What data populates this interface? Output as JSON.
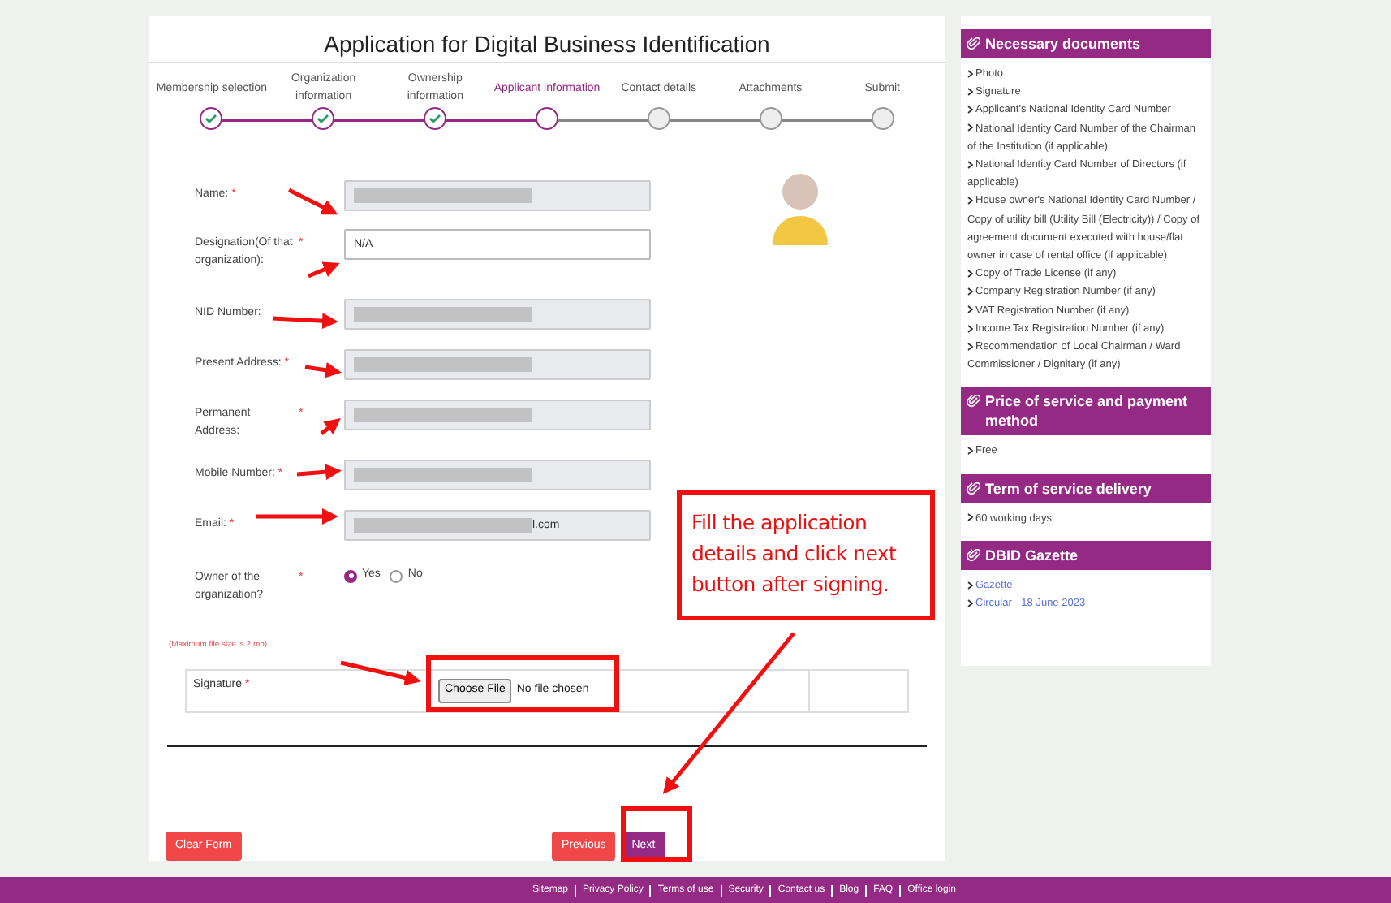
{
  "title": "Application for Digital Business Identification",
  "steps": [
    {
      "label": "Membership selection",
      "completed": true,
      "current": false
    },
    {
      "label": "Organization information",
      "completed": true,
      "current": false
    },
    {
      "label": "Ownership information",
      "completed": true,
      "current": false
    },
    {
      "label": "Applicant information",
      "completed": false,
      "current": true
    },
    {
      "label": "Contact details",
      "completed": false,
      "current": false
    },
    {
      "label": "Attachments",
      "completed": false,
      "current": false
    },
    {
      "label": "Submit",
      "completed": false,
      "current": false
    }
  ],
  "fields": [
    {
      "kind": "text",
      "label": "Name:",
      "required_mark": "*",
      "disabled": true,
      "redacted": true
    },
    {
      "kind": "text",
      "label": "Designation(Of that organization):",
      "required_mark": "*",
      "disabled": false,
      "value": "N/A"
    },
    {
      "kind": "text",
      "label": "NID Number:",
      "disabled": true,
      "redacted": true
    },
    {
      "kind": "text",
      "label": "Present Address:",
      "required_mark": "*",
      "disabled": true,
      "redacted": true
    },
    {
      "kind": "text",
      "label": "Permanent Address:",
      "required_mark": "*",
      "disabled": true,
      "redacted": true
    },
    {
      "kind": "text",
      "label": "Mobile Number:",
      "required_mark": "*",
      "disabled": true,
      "redacted": true
    },
    {
      "kind": "text",
      "label": "Email:",
      "required_mark": "*",
      "disabled": true,
      "redacted": true,
      "value": "l.com"
    },
    {
      "kind": "radio",
      "label": "Owner of the organization?",
      "required_mark": "*",
      "options": [
        {
          "label": "Yes",
          "selected": true
        },
        {
          "label": "No",
          "selected": false
        }
      ]
    }
  ],
  "file_note": "(Maximum file size is 2 mb)",
  "signature": {
    "label": "Signature",
    "required_mark": "*",
    "button": "Choose File",
    "status": "No file chosen"
  },
  "buttons": {
    "clear": "Clear Form",
    "previous": "Previous",
    "next": "Next"
  },
  "callout": "Fill the application details and click next button after signing.",
  "sidebar": [
    {
      "title": "Necessary documents",
      "items": [
        {
          "text": "Photo",
          "kind": "text"
        },
        {
          "text": "Signature",
          "kind": "text"
        },
        {
          "text": "Applicant's National Identity Card Number",
          "kind": "text"
        },
        {
          "text": "National Identity Card Number of the Chairman of the Institution (if applicable)",
          "kind": "text"
        },
        {
          "text": "National Identity Card Number of Directors (if applicable)",
          "kind": "text"
        },
        {
          "text": "House owner's National Identity Card Number / Copy of utility bill (Utility Bill (Electricity)) / Copy of agreement document executed with house/flat owner in case of rental office (if applicable)",
          "kind": "text"
        },
        {
          "text": "Copy of Trade License (if any)",
          "kind": "text"
        },
        {
          "text": "Company Registration Number (if any)",
          "kind": "text"
        },
        {
          "text": "VAT Registration Number (if any)",
          "kind": "text"
        },
        {
          "text": "Income Tax Registration Number (if any)",
          "kind": "text"
        },
        {
          "text": "Recommendation of Local Chairman / Ward Commissioner / Dignitary (if any)",
          "kind": "text"
        }
      ]
    },
    {
      "title": "Price of service and payment method",
      "items": [
        {
          "text": "Free",
          "kind": "text"
        }
      ]
    },
    {
      "title": "Term of service delivery",
      "items": [
        {
          "text": "60 working days",
          "kind": "text"
        }
      ]
    },
    {
      "title": "DBID Gazette",
      "items": [
        {
          "text": "Gazette",
          "kind": "link"
        },
        {
          "text": "Circular - 18 June 2023",
          "kind": "link"
        }
      ]
    }
  ],
  "footer": [
    "Sitemap",
    "Privacy Policy",
    "Terms of use",
    "Security",
    "Contact us",
    "Blog",
    "FAQ",
    "Office login"
  ]
}
